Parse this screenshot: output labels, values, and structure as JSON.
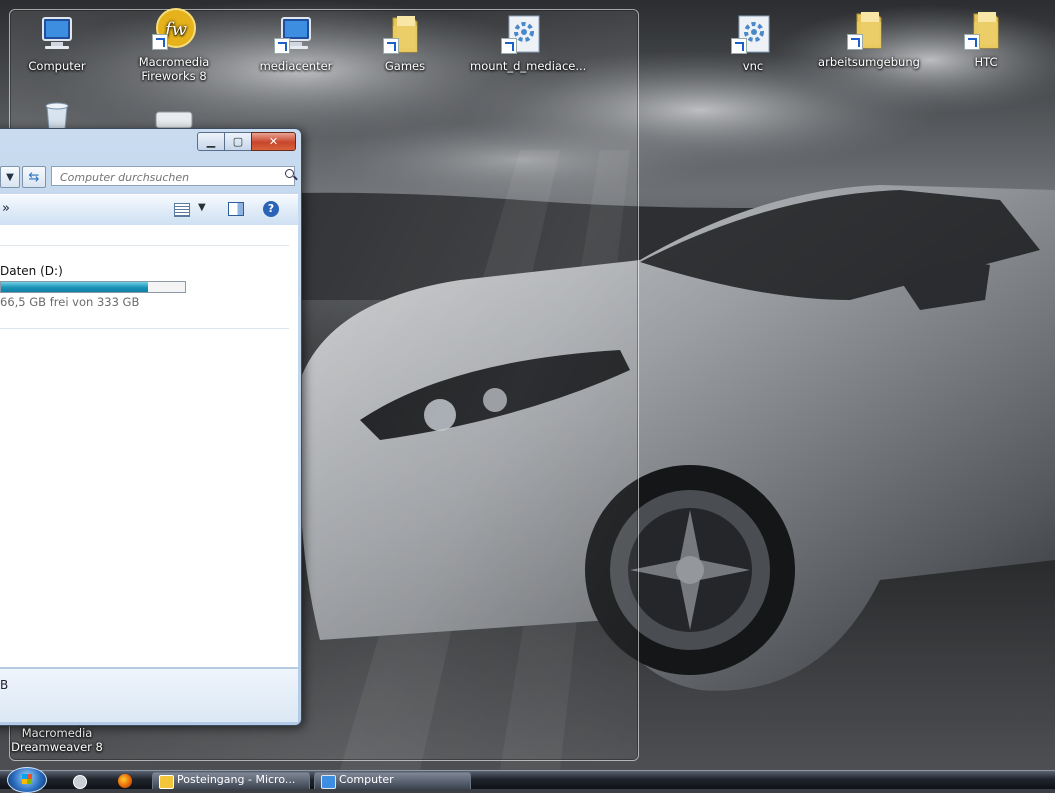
{
  "desktop": {
    "icons": [
      {
        "label": "Computer",
        "icon": "computer-icon"
      },
      {
        "label": "Macromedia Fireworks 8",
        "icon": "fireworks-icon"
      },
      {
        "label": "mediacenter",
        "icon": "computer-icon"
      },
      {
        "label": "Games",
        "icon": "folder-icon"
      },
      {
        "label": "mount_d_mediace...",
        "icon": "script-icon"
      },
      {
        "label": "vnc",
        "icon": "script-icon"
      },
      {
        "label": "arbeitsumgebung",
        "icon": "folder-icon"
      },
      {
        "label": "HTC",
        "icon": "folder-icon"
      }
    ],
    "bottom_icon_label_1": "Macromedia",
    "bottom_icon_label_2": "Dreamweaver 8"
  },
  "explorer": {
    "search_placeholder": "Computer durchsuchen",
    "more_chevron": "»",
    "drive": {
      "label": "Daten (D:)",
      "free_text": "66,5 GB frei von 333 GB",
      "used_fraction": 0.8
    },
    "details_text": "B"
  },
  "taskbar": {
    "buttons": [
      {
        "label": "Posteingang - Micro...",
        "icon": "outlook-icon"
      },
      {
        "label": "Computer",
        "icon": "computer-icon"
      }
    ]
  },
  "colors": {
    "accent": "#1c92b6",
    "window_frame": "#b3cbe6",
    "close_button": "#c7462c"
  }
}
